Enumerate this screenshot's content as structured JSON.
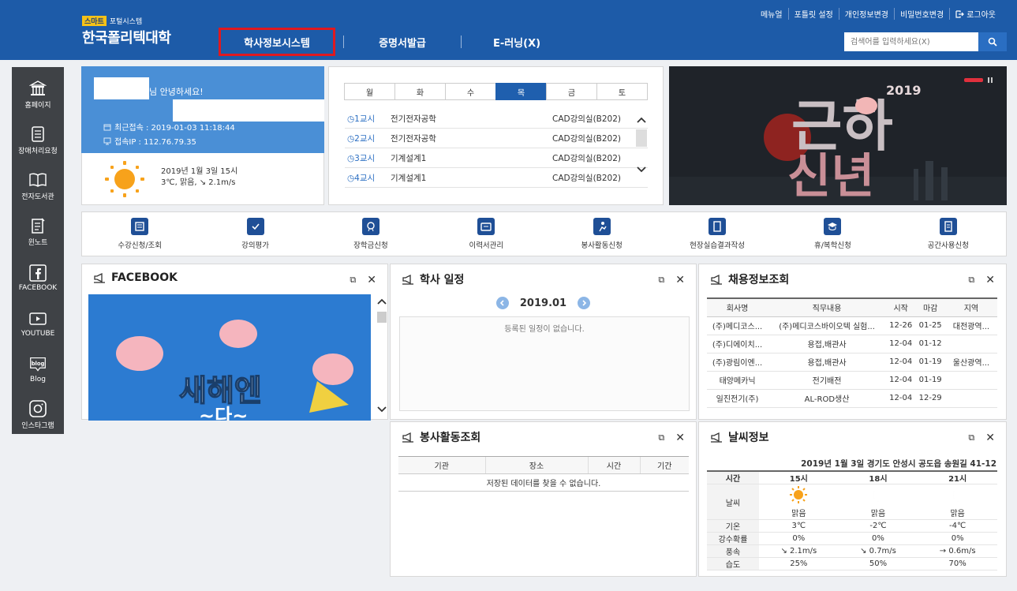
{
  "header": {
    "logo_badge": "스마트",
    "logo_sub": "포털시스템",
    "logo_title": "한국폴리텍대학",
    "nav": [
      "학사정보시스템",
      "증명서발급",
      "E-러닝(X)"
    ],
    "util": [
      "메뉴얼",
      "포틀릿 설정",
      "개인정보변경",
      "비밀번호변경",
      "로그아웃"
    ],
    "search_placeholder": "검색어를 입력하세요(X)",
    "brand_color": "#1d5ba8",
    "highlight_color": "#e0191f"
  },
  "sidebar": [
    {
      "label": "홈페이지",
      "icon": "building-icon"
    },
    {
      "label": "장애처리요청",
      "icon": "document-icon"
    },
    {
      "label": "전자도서관",
      "icon": "book-icon"
    },
    {
      "label": "윈노트",
      "icon": "notepad-icon"
    },
    {
      "label": "FACEBOOK",
      "icon": "facebook-icon"
    },
    {
      "label": "YOUTUBE",
      "icon": "youtube-icon"
    },
    {
      "label": "Blog",
      "icon": "blog-icon"
    },
    {
      "label": "인스타그램",
      "icon": "instagram-icon"
    }
  ],
  "welcome": {
    "greeting": "님 안녕하세요!",
    "last_login": "최근접속 : 2019-01-03 11:18:44",
    "ip": "접속IP : 112.76.79.35",
    "weather_date": "2019년 1월 3일 15시",
    "weather_desc": "3℃, 맑음, ↘ 2.1m/s"
  },
  "timetable": {
    "days": [
      "월",
      "화",
      "수",
      "목",
      "금",
      "토"
    ],
    "active_day": "목",
    "periods": [
      {
        "label": "1교시",
        "subject": "전기전자공학",
        "room": "CAD강의실(B202)"
      },
      {
        "label": "2교시",
        "subject": "전기전자공학",
        "room": "CAD강의실(B202)"
      },
      {
        "label": "3교시",
        "subject": "기계설계1",
        "room": "CAD강의실(B202)"
      },
      {
        "label": "4교시",
        "subject": "기계설계1",
        "room": "CAD강의실(B202)"
      }
    ]
  },
  "banner": {
    "year": "2019",
    "text1": "근하",
    "text2": "신년"
  },
  "quick_menu": [
    {
      "label": "수강신청/조회",
      "icon": "register-icon"
    },
    {
      "label": "강의평가",
      "icon": "evaluation-icon"
    },
    {
      "label": "장학금신청",
      "icon": "scholarship-icon"
    },
    {
      "label": "이력서관리",
      "icon": "resume-icon"
    },
    {
      "label": "봉사활동신청",
      "icon": "volunteer-icon"
    },
    {
      "label": "현장실습결과작성",
      "icon": "report-icon"
    },
    {
      "label": "휴/복학신청",
      "icon": "graduation-icon"
    },
    {
      "label": "공간사용신청",
      "icon": "space-icon"
    }
  ],
  "facebook": {
    "title": "FACEBOOK",
    "image_text1": "새해엔",
    "image_text2": "~다~"
  },
  "schedule": {
    "title": "학사 일정",
    "month": "2019.01",
    "empty": "등록된 일정이 없습니다."
  },
  "jobs": {
    "title": "채용정보조회",
    "columns": [
      "회사명",
      "직무내용",
      "시작",
      "마감",
      "지역"
    ],
    "rows": [
      [
        "(주)메디코스...",
        "(주)메디코스바이오텍 실험...",
        "12-26",
        "01-25",
        "대전광역..."
      ],
      [
        "(주)디에이치...",
        "용접,배관사",
        "12-04",
        "01-12",
        ""
      ],
      [
        "(주)광림이엔...",
        "용접,배관사",
        "12-04",
        "01-19",
        "울산광역..."
      ],
      [
        "태양메카닉",
        "전기배전",
        "12-04",
        "01-19",
        ""
      ],
      [
        "일진전기(주)",
        "AL-ROD생산",
        "12-04",
        "12-29",
        ""
      ]
    ]
  },
  "service": {
    "title": "봉사활동조회",
    "columns": [
      "기관",
      "장소",
      "시간",
      "기간"
    ],
    "empty": "저장된 데이터를 찾을 수 없습니다."
  },
  "weather": {
    "title": "날씨정보",
    "location": "2019년 1월 3일 경기도 안성시 공도읍 송원길 41-12",
    "row_labels": [
      "시간",
      "날씨",
      "기온",
      "강수확률",
      "풍속",
      "습도"
    ],
    "times": [
      "15시",
      "18시",
      "21시"
    ],
    "conditions": [
      "맑음",
      "맑음",
      "맑음"
    ],
    "temps": [
      "3℃",
      "-2℃",
      "-4℃"
    ],
    "rain": [
      "0%",
      "0%",
      "0%"
    ],
    "wind": [
      "↘ 2.1m/s",
      "↘ 0.7m/s",
      "→ 0.6m/s"
    ],
    "humidity": [
      "25%",
      "50%",
      "70%"
    ]
  }
}
